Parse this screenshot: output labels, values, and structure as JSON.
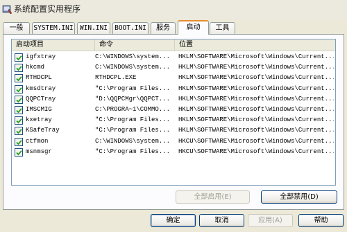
{
  "window": {
    "title": "系统配置实用程序"
  },
  "tabs": [
    {
      "label": "一般"
    },
    {
      "label": "SYSTEM.INI"
    },
    {
      "label": "WIN.INI"
    },
    {
      "label": "BOOT.INI"
    },
    {
      "label": "服务"
    },
    {
      "label": "启动"
    },
    {
      "label": "工具"
    }
  ],
  "active_tab": "启动",
  "list": {
    "columns": [
      "启动项目",
      "命令",
      "位置"
    ],
    "rows": [
      {
        "checked": true,
        "item": "igfxtray",
        "command": "C:\\WINDOWS\\system...",
        "location": "HKLM\\SOFTWARE\\Microsoft\\Windows\\Current..."
      },
      {
        "checked": true,
        "item": "hkcmd",
        "command": "C:\\WINDOWS\\system...",
        "location": "HKLM\\SOFTWARE\\Microsoft\\Windows\\Current..."
      },
      {
        "checked": true,
        "item": "RTHDCPL",
        "command": "RTHDCPL.EXE",
        "location": "HKLM\\SOFTWARE\\Microsoft\\Windows\\Current..."
      },
      {
        "checked": true,
        "item": "kmsdtray",
        "command": "\"C:\\Program Files...",
        "location": "HKLM\\SOFTWARE\\Microsoft\\Windows\\Current..."
      },
      {
        "checked": true,
        "item": "QQPCTray",
        "command": "\"D:\\QQPCMgr\\QQPCT...",
        "location": "HKLM\\SOFTWARE\\Microsoft\\Windows\\Current..."
      },
      {
        "checked": true,
        "item": "IMSCMIG",
        "command": "C:\\PROGRA~1\\COMMO...",
        "location": "HKLM\\SOFTWARE\\Microsoft\\Windows\\Current..."
      },
      {
        "checked": true,
        "item": "kxetray",
        "command": "\"C:\\Program Files...",
        "location": "HKLM\\SOFTWARE\\Microsoft\\Windows\\Current..."
      },
      {
        "checked": true,
        "item": "KSafeTray",
        "command": "\"C:\\Program Files...",
        "location": "HKLM\\SOFTWARE\\Microsoft\\Windows\\Current..."
      },
      {
        "checked": true,
        "item": "ctfmon",
        "command": "C:\\WINDOWS\\system...",
        "location": "HKCU\\SOFTWARE\\Microsoft\\Windows\\Current..."
      },
      {
        "checked": true,
        "item": "msnmsgr",
        "command": "\"C:\\Program Files...",
        "location": "HKCU\\SOFTWARE\\Microsoft\\Windows\\Current..."
      }
    ]
  },
  "buttons": {
    "enable_all": "全部启用(E)",
    "disable_all": "全部禁用(D)",
    "ok": "确定",
    "cancel": "取消",
    "apply": "应用(A)",
    "help": "帮助"
  },
  "colors": {
    "active_tab_accent": "#e68b2c",
    "checkbox_check": "#21a121",
    "list_border": "#7f9db9"
  }
}
